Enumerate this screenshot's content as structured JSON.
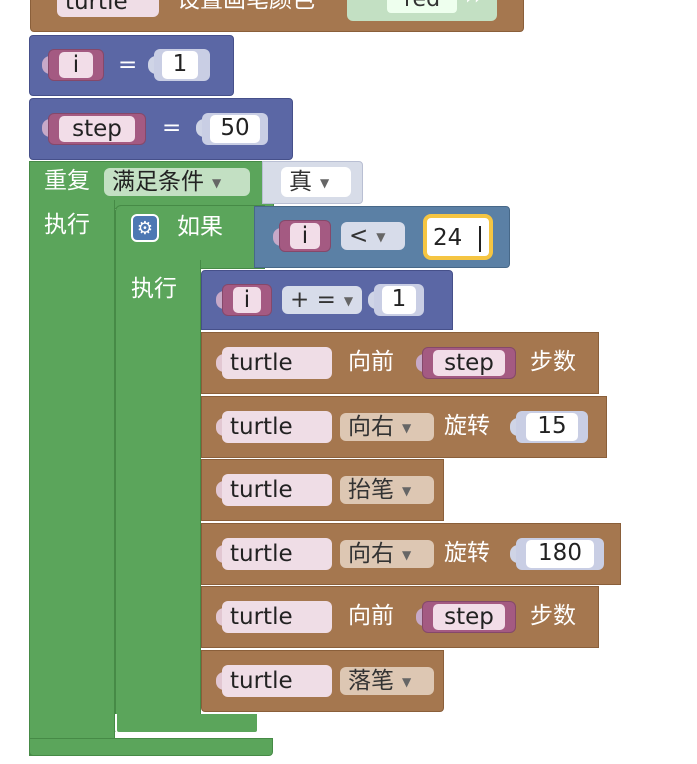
{
  "blocks": {
    "pencolor": {
      "object": "turtle",
      "action": "设置画笔颜色",
      "value": "red",
      "quote": "››"
    },
    "set_i": {
      "var": "i",
      "op": "=",
      "value": "1"
    },
    "set_step": {
      "var": "step",
      "op": "=",
      "value": "50"
    },
    "repeat": {
      "label": "重复",
      "mode": "满足条件",
      "condition": "真",
      "do_label": "执行"
    },
    "if": {
      "label": "如果",
      "do_label": "执行",
      "left": "i",
      "op": "<",
      "right": "24"
    },
    "inc": {
      "var": "i",
      "op": "+ =",
      "value": "1"
    },
    "fwd1": {
      "object": "turtle",
      "action": "向前",
      "arg": "step",
      "unit": "步数"
    },
    "right1": {
      "object": "turtle",
      "dir": "向右",
      "action": "旋转",
      "value": "15"
    },
    "penup": {
      "object": "turtle",
      "action": "抬笔"
    },
    "right2": {
      "object": "turtle",
      "dir": "向右",
      "action": "旋转",
      "value": "180"
    },
    "fwd2": {
      "object": "turtle",
      "action": "向前",
      "arg": "step",
      "unit": "步数"
    },
    "pendown": {
      "object": "turtle",
      "action": "落笔"
    }
  },
  "colors": {
    "turtle_block": "#a5774f",
    "variable_block": "#5b67a5",
    "loop_block": "#5ba55b",
    "logic_block": "#5b80a5",
    "selection": "#f5c542"
  }
}
